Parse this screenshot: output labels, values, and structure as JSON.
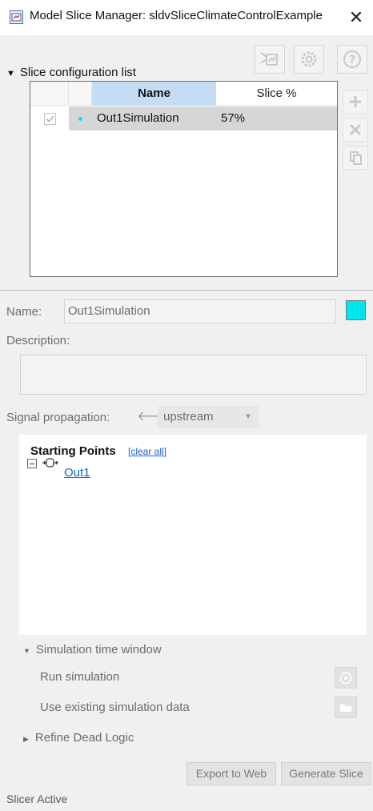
{
  "window": {
    "title": "Model Slice Manager: sldvSliceClimateControlExample",
    "close_glyph": "✕"
  },
  "config_section": {
    "toggle_label": "Slice configuration list",
    "table": {
      "columns": [
        "Name",
        "Slice %"
      ],
      "rows": [
        {
          "checked": true,
          "color": "#00e5ee",
          "name": "Out1Simulation",
          "slice_pct": "57%"
        }
      ]
    },
    "toolbar_icons": [
      "slice-model-icon",
      "settings-icon",
      "help-icon"
    ],
    "side_icons": [
      "add-icon",
      "delete-icon",
      "copy-icon"
    ]
  },
  "properties": {
    "name_label": "Name:",
    "name_value": "Out1Simulation",
    "swatch_color": "#00e5ee",
    "description_label": "Description:",
    "description_value": "",
    "signal_propagation_label": "Signal propagation:",
    "propagation_value": "upstream"
  },
  "starting_points": {
    "heading": "Starting Points",
    "clear_all": "[clear all]",
    "items": [
      {
        "label": "Out1"
      }
    ]
  },
  "simulation_window": {
    "toggle_label": "Simulation time window",
    "run_label": "Run simulation",
    "existing_label": "Use existing simulation data"
  },
  "refine": {
    "toggle_label": "Refine Dead Logic"
  },
  "buttons": {
    "export_label": "Export to Web",
    "generate_label": "Generate Slice"
  },
  "status": {
    "text": "Slicer Active"
  }
}
